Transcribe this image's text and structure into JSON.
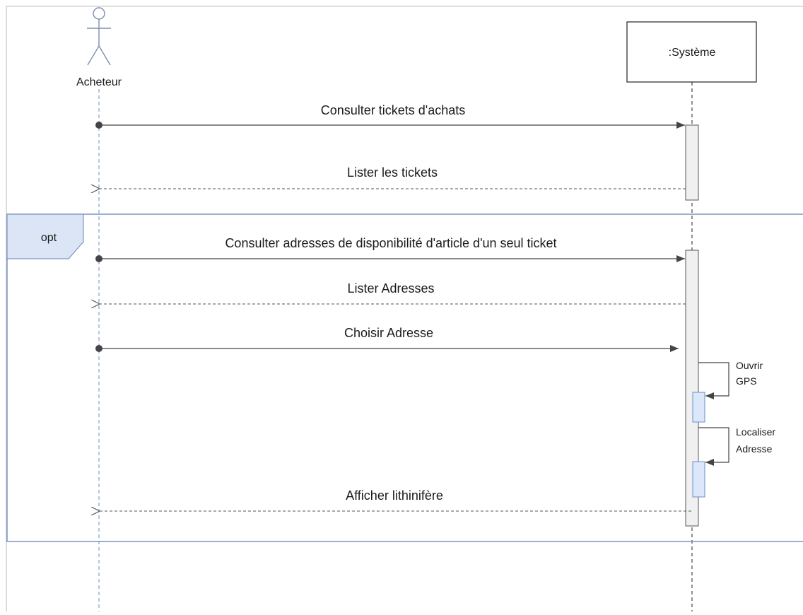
{
  "participants": {
    "actor": {
      "label": "Acheteur"
    },
    "system": {
      "label": ":Système"
    }
  },
  "fragment": {
    "operator": "opt"
  },
  "messages": [
    {
      "label": "Consulter tickets d'achats",
      "kind": "sync"
    },
    {
      "label": "Lister les tickets",
      "kind": "return"
    },
    {
      "label": "Consulter adresses de disponibilité d'article d'un seul ticket",
      "kind": "sync"
    },
    {
      "label": "Lister Adresses",
      "kind": "return"
    },
    {
      "label": "Choisir Adresse",
      "kind": "sync"
    },
    {
      "label": "Afficher lithinifère",
      "kind": "return"
    }
  ],
  "self_messages": [
    {
      "line1": "Ouvrir",
      "line2": "GPS"
    },
    {
      "line1": "Localiser",
      "line2": "Adresse"
    }
  ],
  "colors": {
    "line": "#444444",
    "frame_border": "#7a96c2",
    "frame_fill": "#dbe5f5",
    "activation_fill": "#f0f0f0",
    "nested_activation_fill": "#dbe7fb",
    "nested_activation_border": "#6d8fc6",
    "actor_stroke": "#7a8fb0"
  }
}
